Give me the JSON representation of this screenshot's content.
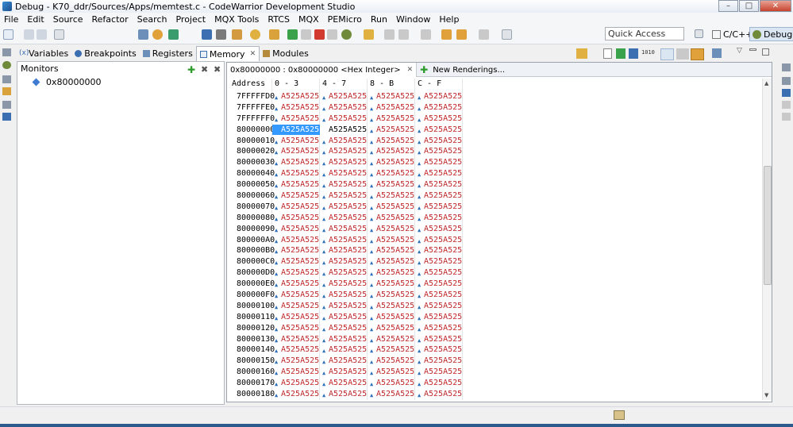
{
  "window": {
    "title": "Debug - K70_ddr/Sources/Apps/memtest.c - CodeWarrior Development Studio"
  },
  "menu": [
    "File",
    "Edit",
    "Source",
    "Refactor",
    "Search",
    "Project",
    "MQX Tools",
    "RTCS",
    "MQX",
    "PEMicro",
    "Run",
    "Window",
    "Help"
  ],
  "toolbar": {
    "quick_access_placeholder": "Quick Access"
  },
  "perspectives": {
    "cpp": "C/C++",
    "debug": "Debug"
  },
  "view_tabs": [
    {
      "label": "Variables",
      "icon": "variables-icon"
    },
    {
      "label": "Breakpoints",
      "icon": "breakpoints-icon"
    },
    {
      "label": "Registers",
      "icon": "registers-icon"
    },
    {
      "label": "Memory",
      "icon": "memory-icon"
    },
    {
      "label": "Modules",
      "icon": "modules-icon"
    }
  ],
  "monitors": {
    "title": "Monitors",
    "items": [
      "0x80000000"
    ]
  },
  "renderings": {
    "active_tab": "0x80000000 : 0x80000000 <Hex Integer>",
    "new_tab": "New Renderings..."
  },
  "memory": {
    "columns": [
      "Address",
      "0 - 3",
      "4 - 7",
      "8 - B",
      "C - F"
    ],
    "rows": [
      {
        "addr": "7FFFFFD0",
        "cells": [
          "A525A525",
          "A525A525",
          "A525A525",
          "A525A525"
        ]
      },
      {
        "addr": "7FFFFFE0",
        "cells": [
          "A525A525",
          "A525A525",
          "A525A525",
          "A525A525"
        ]
      },
      {
        "addr": "7FFFFFF0",
        "cells": [
          "A525A525",
          "A525A525",
          "A525A525",
          "A525A525"
        ]
      },
      {
        "addr": "80000000",
        "cells": [
          "A525A525",
          "A525A525",
          "A525A525",
          "A525A525"
        ]
      },
      {
        "addr": "80000010",
        "cells": [
          "A525A525",
          "A525A525",
          "A525A525",
          "A525A525"
        ]
      },
      {
        "addr": "80000020",
        "cells": [
          "A525A525",
          "A525A525",
          "A525A525",
          "A525A525"
        ]
      },
      {
        "addr": "80000030",
        "cells": [
          "A525A525",
          "A525A525",
          "A525A525",
          "A525A525"
        ]
      },
      {
        "addr": "80000040",
        "cells": [
          "A525A525",
          "A525A525",
          "A525A525",
          "A525A525"
        ]
      },
      {
        "addr": "80000050",
        "cells": [
          "A525A525",
          "A525A525",
          "A525A525",
          "A525A525"
        ]
      },
      {
        "addr": "80000060",
        "cells": [
          "A525A525",
          "A525A525",
          "A525A525",
          "A525A525"
        ]
      },
      {
        "addr": "80000070",
        "cells": [
          "A525A525",
          "A525A525",
          "A525A525",
          "A525A525"
        ]
      },
      {
        "addr": "80000080",
        "cells": [
          "A525A525",
          "A525A525",
          "A525A525",
          "A525A525"
        ]
      },
      {
        "addr": "80000090",
        "cells": [
          "A525A525",
          "A525A525",
          "A525A525",
          "A525A525"
        ]
      },
      {
        "addr": "800000A0",
        "cells": [
          "A525A525",
          "A525A525",
          "A525A525",
          "A525A525"
        ]
      },
      {
        "addr": "800000B0",
        "cells": [
          "A525A525",
          "A525A525",
          "A525A525",
          "A525A525"
        ]
      },
      {
        "addr": "800000C0",
        "cells": [
          "A525A525",
          "A525A525",
          "A525A525",
          "A525A525"
        ]
      },
      {
        "addr": "800000D0",
        "cells": [
          "A525A525",
          "A525A525",
          "A525A525",
          "A525A525"
        ]
      },
      {
        "addr": "800000E0",
        "cells": [
          "A525A525",
          "A525A525",
          "A525A525",
          "A525A525"
        ]
      },
      {
        "addr": "800000F0",
        "cells": [
          "A525A525",
          "A525A525",
          "A525A525",
          "A525A525"
        ]
      },
      {
        "addr": "80000100",
        "cells": [
          "A525A525",
          "A525A525",
          "A525A525",
          "A525A525"
        ]
      },
      {
        "addr": "80000110",
        "cells": [
          "A525A525",
          "A525A525",
          "A525A525",
          "A525A525"
        ]
      },
      {
        "addr": "80000120",
        "cells": [
          "A525A525",
          "A525A525",
          "A525A525",
          "A525A525"
        ]
      },
      {
        "addr": "80000130",
        "cells": [
          "A525A525",
          "A525A525",
          "A525A525",
          "A525A525"
        ]
      },
      {
        "addr": "80000140",
        "cells": [
          "A525A525",
          "A525A525",
          "A525A525",
          "A525A525"
        ]
      },
      {
        "addr": "80000150",
        "cells": [
          "A525A525",
          "A525A525",
          "A525A525",
          "A525A525"
        ]
      },
      {
        "addr": "80000160",
        "cells": [
          "A525A525",
          "A525A525",
          "A525A525",
          "A525A525"
        ]
      },
      {
        "addr": "80000170",
        "cells": [
          "A525A525",
          "A525A525",
          "A525A525",
          "A525A525"
        ]
      },
      {
        "addr": "80000180",
        "cells": [
          "A525A525",
          "A525A525",
          "A525A525",
          "A525A525"
        ]
      }
    ],
    "selected_cell": {
      "row": 3,
      "col": 0
    },
    "plain_cell": {
      "row": 3,
      "col": 1
    },
    "value_color": "#c0282a",
    "selection_color": "#3399ff"
  }
}
